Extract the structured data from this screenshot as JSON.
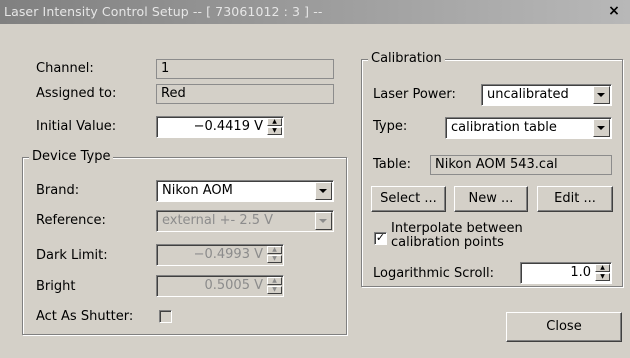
{
  "window": {
    "title": "Laser Intensity Control Setup -- [ 73061012 : 3  ] --",
    "close_glyph": "×"
  },
  "channel": {
    "channel_label": "Channel:",
    "channel_value": "1",
    "assigned_label": "Assigned to:",
    "assigned_value": "Red",
    "initial_label": "Initial Value:",
    "initial_value": "−0.4419 V"
  },
  "device_type": {
    "title": "Device Type",
    "brand_label": "Brand:",
    "brand_value": "Nikon AOM",
    "reference_label": "Reference:",
    "reference_value": "external +- 2.5 V",
    "dark_label": "Dark Limit:",
    "dark_value": "−0.4993 V",
    "bright_label": "Bright",
    "bright_value": "0.5005 V",
    "shutter_label": "Act As Shutter:",
    "shutter_checked": false
  },
  "calibration": {
    "title": "Calibration",
    "power_label": "Laser Power:",
    "power_value": "uncalibrated",
    "type_label": "Type:",
    "type_value": "calibration table",
    "table_label": "Table:",
    "table_value": "Nikon AOM 543.cal",
    "select_label": "Select ...",
    "new_label": "New ...",
    "edit_label": "Edit ...",
    "interp_label_1": "Interpolate between",
    "interp_label_2": "calibration points",
    "interp_checked": true,
    "interp_glyph": "✓",
    "log_label": "Logarithmic Scroll:",
    "log_value": "1.0"
  },
  "footer": {
    "close_label": "Close"
  },
  "icons": {
    "spin_up": "▲",
    "spin_down": "▼"
  }
}
